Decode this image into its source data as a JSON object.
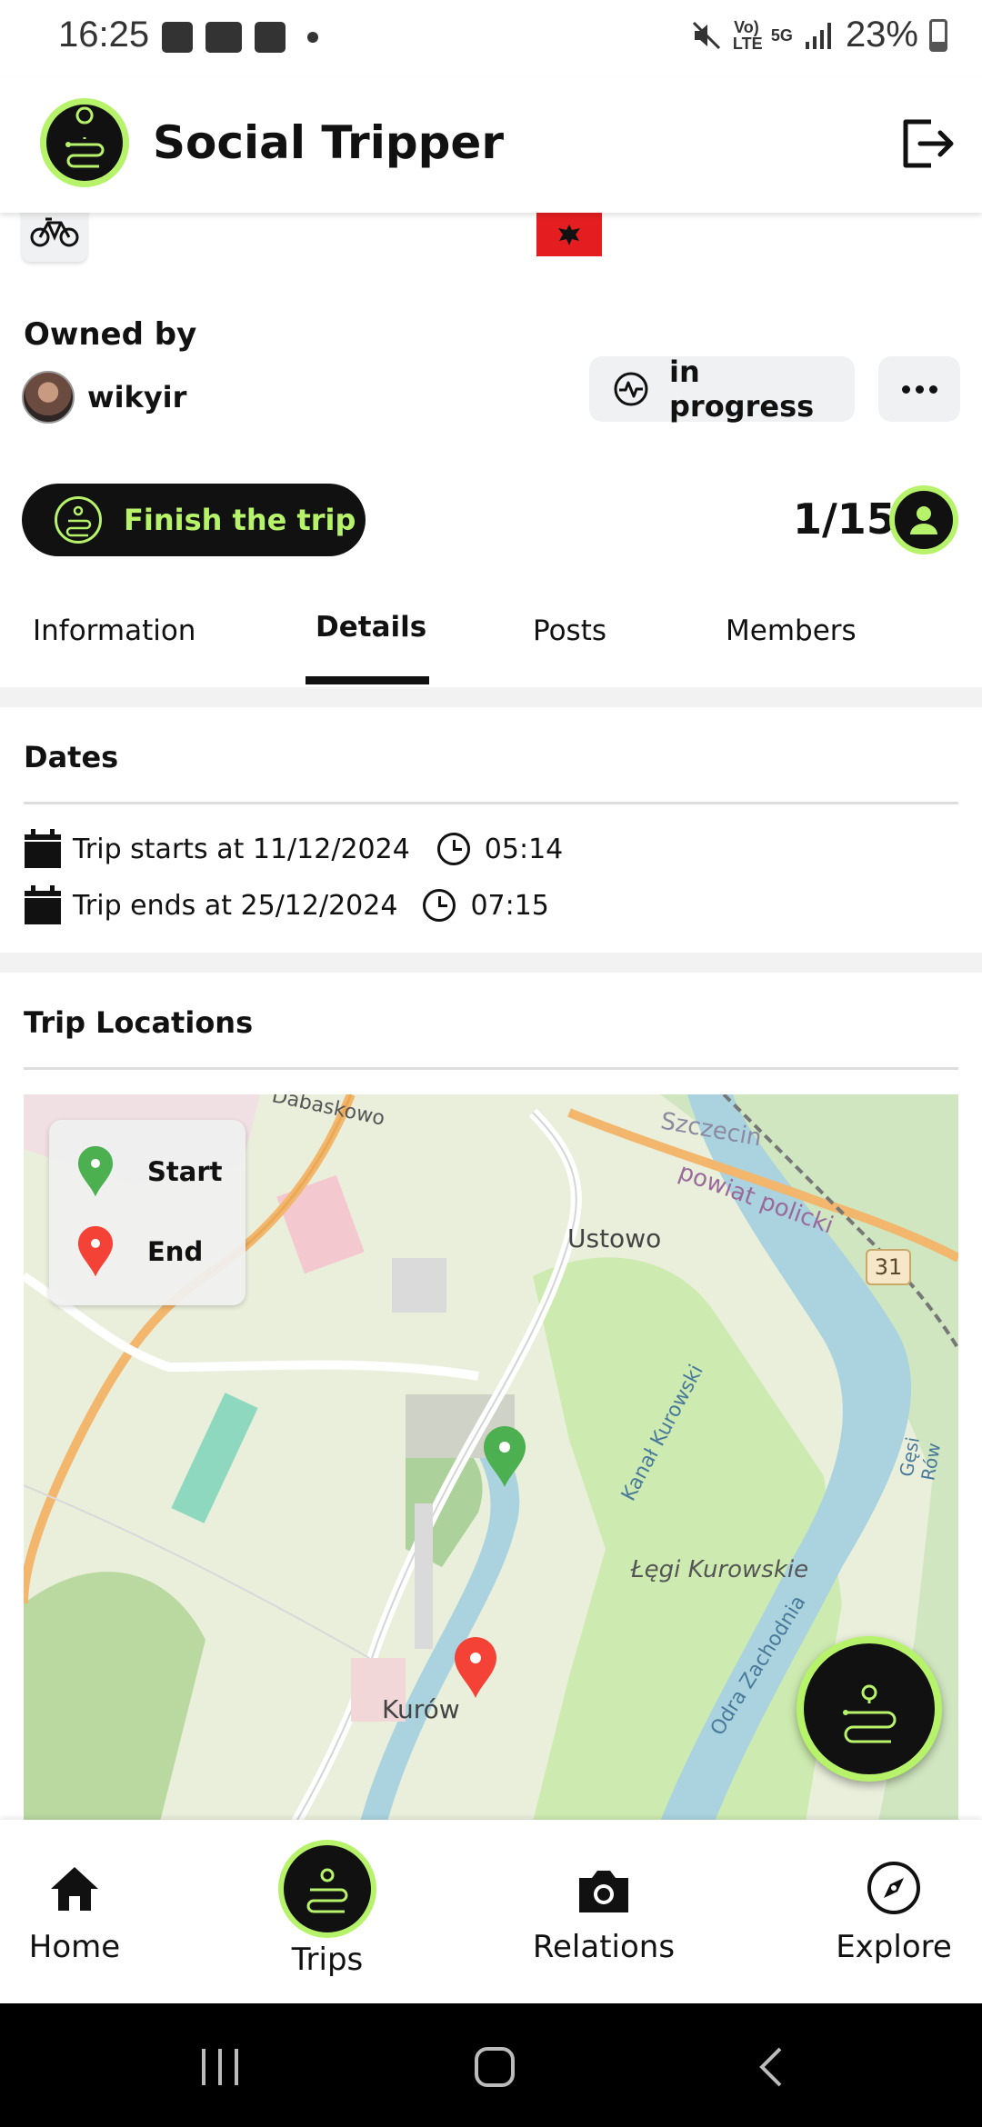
{
  "status_bar": {
    "time": "16:25",
    "battery": "23%",
    "network": "5G",
    "volte": "Vo) LTE"
  },
  "app": {
    "title": "Social Tripper"
  },
  "trip": {
    "owned_label": "Owned by",
    "owner": "wikyir",
    "status": "in progress",
    "finish_label": "Finish the trip",
    "members_count": "1/15"
  },
  "tabs": [
    {
      "label": "Information"
    },
    {
      "label": "Details"
    },
    {
      "label": "Posts"
    },
    {
      "label": "Members"
    }
  ],
  "dates": {
    "title": "Dates",
    "start_text": "Trip starts at 11/12/2024",
    "start_time": "05:14",
    "end_text": "Trip ends at 25/12/2024",
    "end_time": "07:15"
  },
  "locations": {
    "title": "Trip Locations",
    "legend": {
      "start": "Start",
      "end": "End"
    },
    "map_labels": {
      "ustowo": "Ustowo",
      "lagi": "Łęgi Kurowskie",
      "kurow": "Kurów",
      "szczecin": "Szczecin",
      "powiat": "powiat policki",
      "kanal": "Kanał Kurowski",
      "odra": "Odra Zachodnia",
      "road": "31",
      "gesi": "Gęsi Rów",
      "dabaskowo": "Dabaskowo"
    }
  },
  "bottom_nav": [
    {
      "label": "Home",
      "icon": "home-icon"
    },
    {
      "label": "Trips",
      "icon": "route-icon"
    },
    {
      "label": "Relations",
      "icon": "camera-icon"
    },
    {
      "label": "Explore",
      "icon": "compass-icon"
    }
  ],
  "colors": {
    "accent": "#b7f36a",
    "start_pin": "#4caf50",
    "end_pin": "#f44336",
    "flag": "#e41e20"
  }
}
